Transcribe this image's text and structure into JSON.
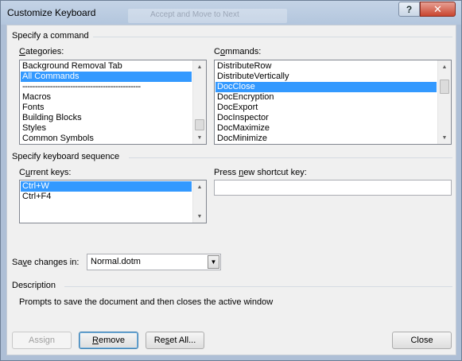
{
  "window": {
    "title": "Customize Keyboard",
    "background_tab_text": "Accept and Move to Next",
    "help_label": "?",
    "close_glyph": "✕"
  },
  "command_section": {
    "heading": "Specify a command",
    "categories_label_pre": "",
    "categories_label_ul": "C",
    "categories_label_post": "ategories:",
    "categories": [
      {
        "label": "Background Removal Tab",
        "selected": false
      },
      {
        "label": "All Commands",
        "selected": true
      },
      {
        "label": "-----------------------------------------------",
        "selected": false
      },
      {
        "label": "Macros",
        "selected": false
      },
      {
        "label": "Fonts",
        "selected": false
      },
      {
        "label": "Building Blocks",
        "selected": false
      },
      {
        "label": "Styles",
        "selected": false
      },
      {
        "label": "Common Symbols",
        "selected": false
      }
    ],
    "commands_label_pre": "C",
    "commands_label_ul": "o",
    "commands_label_post": "mmands:",
    "commands": [
      {
        "label": "DistributeRow",
        "selected": false
      },
      {
        "label": "DistributeVertically",
        "selected": false
      },
      {
        "label": "DocClose",
        "selected": true
      },
      {
        "label": "DocEncryption",
        "selected": false
      },
      {
        "label": "DocExport",
        "selected": false
      },
      {
        "label": "DocInspector",
        "selected": false
      },
      {
        "label": "DocMaximize",
        "selected": false
      },
      {
        "label": "DocMinimize",
        "selected": false
      }
    ]
  },
  "keyboard_section": {
    "heading": "Specify keyboard sequence",
    "current_keys_label_pre": "C",
    "current_keys_label_ul": "u",
    "current_keys_label_post": "rrent keys:",
    "current_keys": [
      {
        "label": "Ctrl+W",
        "selected": true
      },
      {
        "label": "Ctrl+F4",
        "selected": false
      }
    ],
    "new_shortcut_label_pre": "Press ",
    "new_shortcut_label_ul": "n",
    "new_shortcut_label_post": "ew shortcut key:",
    "new_shortcut_value": ""
  },
  "save_changes": {
    "label_pre": "Sa",
    "label_ul": "v",
    "label_post": "e changes in:",
    "value": "Normal.dotm"
  },
  "description": {
    "heading": "Description",
    "text": "Prompts to save the document and then closes the active window"
  },
  "buttons": {
    "assign": "Assign",
    "remove_ul": "R",
    "remove_rest": "emove",
    "reset_pre": "Re",
    "reset_ul": "s",
    "reset_post": "et All...",
    "close": "Close"
  }
}
